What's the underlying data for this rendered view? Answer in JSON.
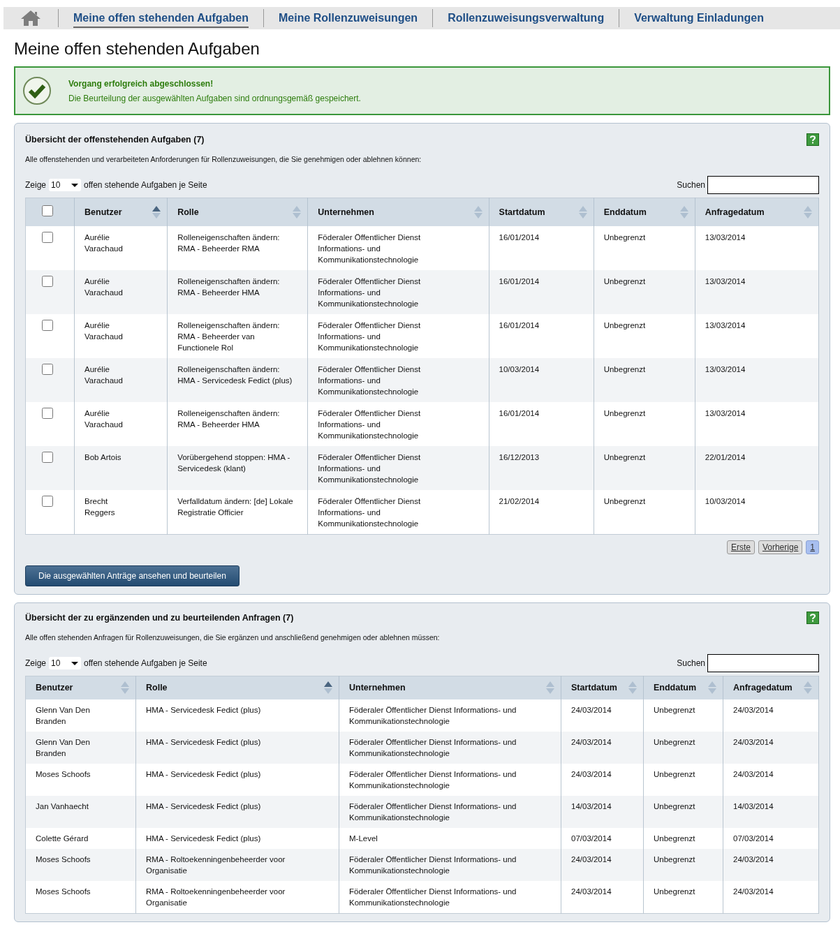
{
  "nav": {
    "tabs": [
      {
        "label": "Meine offen stehenden Aufgaben",
        "selected": true
      },
      {
        "label": "Meine Rollenzuweisungen",
        "selected": false
      },
      {
        "label": "Rollenzuweisungsverwaltung",
        "selected": false
      },
      {
        "label": "Verwaltung Einladungen",
        "selected": false
      }
    ]
  },
  "page_title": "Meine offen stehenden Aufgaben",
  "message": {
    "kind": "success",
    "title": "Vorgang erfolgreich abgeschlossen!",
    "text": "Die Beurteilung der ausgewählten Aufgaben sind ordnungsgemäß gespeichert."
  },
  "panels": [
    {
      "title": "Übersicht der offenstehenden Aufgaben (7)",
      "description": "Alle offenstehenden und verarbeiteten Anforderungen für Rollenzuweisungen, die Sie genehmigen oder ablehnen können:",
      "length_prefix": "Zeige",
      "page_length": "10",
      "length_suffix": "offen stehende Aufgaben je Seite",
      "search_label": "Suchen",
      "select_all": {
        "checked": false
      },
      "columns": [
        {
          "label": "Benutzer",
          "sorted": true
        },
        {
          "label": "Rolle",
          "sorted": false
        },
        {
          "label": "Unternehmen",
          "sorted": false
        },
        {
          "label": "Startdatum",
          "sorted": false
        },
        {
          "label": "Enddatum",
          "sorted": false
        },
        {
          "label": "Anfragedatum",
          "sorted": false
        }
      ],
      "rows": [
        {
          "checked": false,
          "cells": [
            "Aurélie Varachaud",
            "Rolleneigenschaften ändern: RMA - Beheerder RMA",
            "Föderaler Öffentlicher Dienst Informations- und Kommunikationstechnologie",
            "16/01/2014",
            "Unbegrenzt",
            "13/03/2014"
          ]
        },
        {
          "checked": false,
          "cells": [
            "Aurélie Varachaud",
            "Rolleneigenschaften ändern: RMA - Beheerder HMA",
            "Föderaler Öffentlicher Dienst Informations- und Kommunikationstechnologie",
            "16/01/2014",
            "Unbegrenzt",
            "13/03/2014"
          ]
        },
        {
          "checked": false,
          "cells": [
            "Aurélie Varachaud",
            "Rolleneigenschaften ändern: RMA - Beheerder van Functionele Rol",
            "Föderaler Öffentlicher Dienst Informations- und Kommunikationstechnologie",
            "16/01/2014",
            "Unbegrenzt",
            "13/03/2014"
          ]
        },
        {
          "checked": false,
          "cells": [
            "Aurélie Varachaud",
            "Rolleneigenschaften ändern: HMA - Servicedesk Fedict (plus)",
            "Föderaler Öffentlicher Dienst Informations- und Kommunikationstechnologie",
            "10/03/2014",
            "Unbegrenzt",
            "13/03/2014"
          ]
        },
        {
          "checked": false,
          "cells": [
            "Aurélie Varachaud",
            "Rolleneigenschaften ändern: RMA - Beheerder HMA",
            "Föderaler Öffentlicher Dienst Informations- und Kommunikationstechnologie",
            "16/01/2014",
            "Unbegrenzt",
            "13/03/2014"
          ]
        },
        {
          "checked": false,
          "cells": [
            "Bob Artois",
            "Vorübergehend stoppen: HMA - Servicedesk (klant)",
            "Föderaler Öffentlicher Dienst Informations- und Kommunikationstechnologie",
            "16/12/2013",
            "Unbegrenzt",
            "22/01/2014"
          ]
        },
        {
          "checked": false,
          "cells": [
            "Brecht Reggers",
            "Verfalldatum ändern: [de] Lokale Registratie Officier",
            "Föderaler Öffentlicher Dienst Informations- und Kommunikationstechnologie",
            "21/02/2014",
            "Unbegrenzt",
            "10/03/2014"
          ]
        }
      ],
      "pagination": [
        {
          "label": "Erste",
          "selected": false
        },
        {
          "label": "Vorherige",
          "selected": false
        },
        {
          "label": "1",
          "selected": true
        }
      ],
      "action": "Die ausgewählten Anträge ansehen und beurteilen"
    },
    {
      "title": "Übersicht der zu ergänzenden und zu beurteilenden Anfragen (7)",
      "description": "Alle offen stehenden Anfragen für Rollenzuweisungen, die Sie ergänzen und anschließend genehmigen oder ablehnen müssen:",
      "length_prefix": "Zeige",
      "page_length": "10",
      "length_suffix": "offen stehende Aufgaben je Seite",
      "search_label": "Suchen",
      "columns": [
        {
          "label": "Benutzer",
          "sorted": false
        },
        {
          "label": "Rolle",
          "sorted": true
        },
        {
          "label": "Unternehmen",
          "sorted": false
        },
        {
          "label": "Startdatum",
          "sorted": false
        },
        {
          "label": "Enddatum",
          "sorted": false
        },
        {
          "label": "Anfragedatum",
          "sorted": false
        }
      ],
      "rows": [
        {
          "cells": [
            "Glenn Van Den Branden",
            "HMA - Servicedesk Fedict (plus)",
            "Föderaler Öffentlicher Dienst Informations- und Kommunikationstechnologie",
            "24/03/2014",
            "Unbegrenzt",
            "24/03/2014"
          ]
        },
        {
          "cells": [
            "Glenn Van Den Branden",
            "HMA - Servicedesk Fedict (plus)",
            "Föderaler Öffentlicher Dienst Informations- und Kommunikationstechnologie",
            "24/03/2014",
            "Unbegrenzt",
            "24/03/2014"
          ]
        },
        {
          "cells": [
            "Moses Schoofs",
            "HMA - Servicedesk Fedict (plus)",
            "Föderaler Öffentlicher Dienst Informations- und Kommunikationstechnologie",
            "24/03/2014",
            "Unbegrenzt",
            "24/03/2014"
          ]
        },
        {
          "cells": [
            "Jan Vanhaecht",
            "HMA - Servicedesk Fedict (plus)",
            "Föderaler Öffentlicher Dienst Informations- und Kommunikationstechnologie",
            "14/03/2014",
            "Unbegrenzt",
            "14/03/2014"
          ]
        },
        {
          "cells": [
            "Colette Gérard",
            "HMA - Servicedesk Fedict (plus)",
            "M-Level",
            "07/03/2014",
            "Unbegrenzt",
            "07/03/2014"
          ]
        },
        {
          "cells": [
            "Moses Schoofs",
            "RMA - Roltoekenningenbeheerder voor Organisatie",
            "Föderaler Öffentlicher Dienst Informations- und Kommunikationstechnologie",
            "24/03/2014",
            "Unbegrenzt",
            "24/03/2014"
          ]
        },
        {
          "cells": [
            "Moses Schoofs",
            "RMA - Roltoekenningenbeheerder voor Organisatie",
            "Föderaler Öffentlicher Dienst Informations- und Kommunikationstechnologie",
            "24/03/2014",
            "Unbegrenzt",
            "24/03/2014"
          ]
        }
      ]
    }
  ]
}
